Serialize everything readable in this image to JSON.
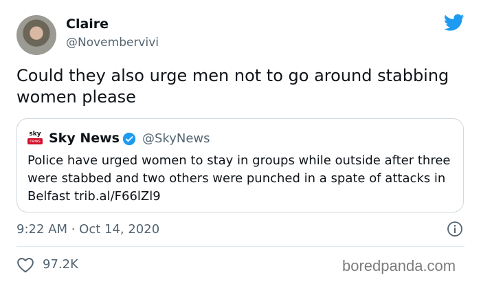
{
  "tweet": {
    "author": {
      "display_name": "Claire",
      "handle": "@Novembervivi"
    },
    "text": "Could they also urge men not to go around stabbing women please",
    "timestamp": "9:22 AM · Oct 14, 2020",
    "likes": "97.2K"
  },
  "quoted_tweet": {
    "logo_sky": "sky",
    "logo_news": "news",
    "display_name": "Sky News",
    "handle": "@SkyNews",
    "text": "Police have urged women to stay in groups while outside after three were stabbed and two others were punched in a spate of attacks in Belfast trib.al/F66lZl9"
  },
  "watermark": "boredpanda.com",
  "icons": {
    "brand": "twitter-bird-icon",
    "verified": "verified-badge-icon",
    "info": "info-icon",
    "like": "heart-icon"
  },
  "colors": {
    "twitter_blue": "#1d9bf0",
    "secondary_text": "#536471",
    "sky_red": "#d3122c"
  }
}
